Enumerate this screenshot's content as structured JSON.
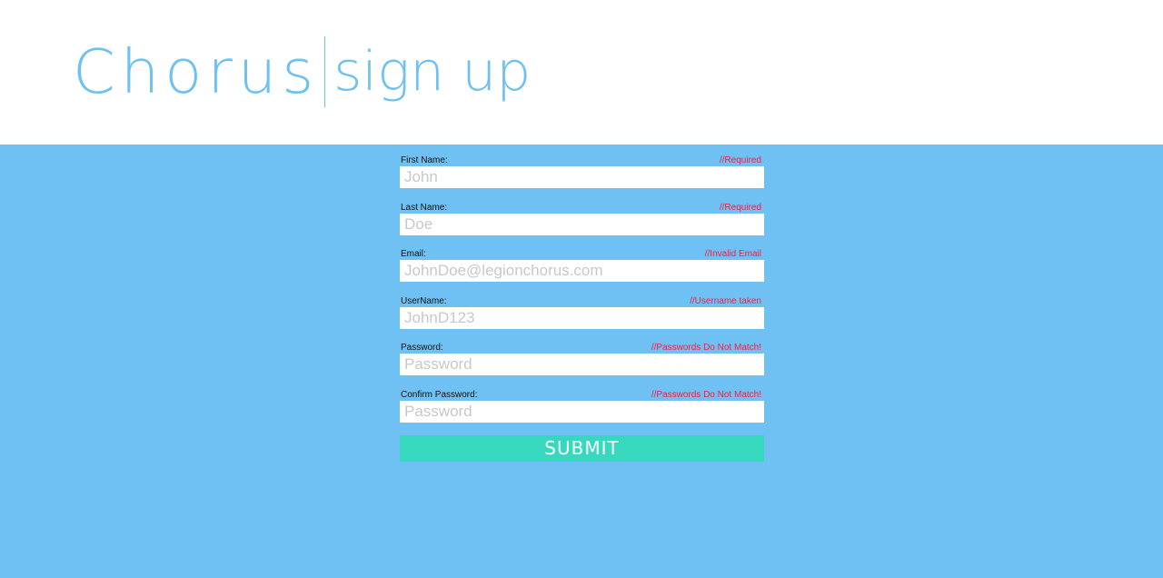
{
  "brand": {
    "name": "Chorus",
    "subtitle": "sign up",
    "color": "#6ec1f1"
  },
  "colors": {
    "background": "#6ec1f2",
    "error": "#ff1a3c",
    "submit": "#36d9bd"
  },
  "form": {
    "fields": [
      {
        "label": "First Name:",
        "error": "//Required",
        "placeholder": "John",
        "type": "text"
      },
      {
        "label": "Last Name:",
        "error": "//Required",
        "placeholder": "Doe",
        "type": "text"
      },
      {
        "label": "Email:",
        "error": "//Invalid Email",
        "placeholder": "JohnDoe@legionchorus.com",
        "type": "email"
      },
      {
        "label": "UserName:",
        "error": "//Username taken",
        "placeholder": "JohnD123",
        "type": "text"
      },
      {
        "label": "Password:",
        "error": "//Passwords Do Not Match!",
        "placeholder": "Password",
        "type": "password"
      },
      {
        "label": "Confirm Password:",
        "error": "//Passwords Do Not Match!",
        "placeholder": "Password",
        "type": "password"
      }
    ],
    "submit_label": "SUBMIT"
  }
}
